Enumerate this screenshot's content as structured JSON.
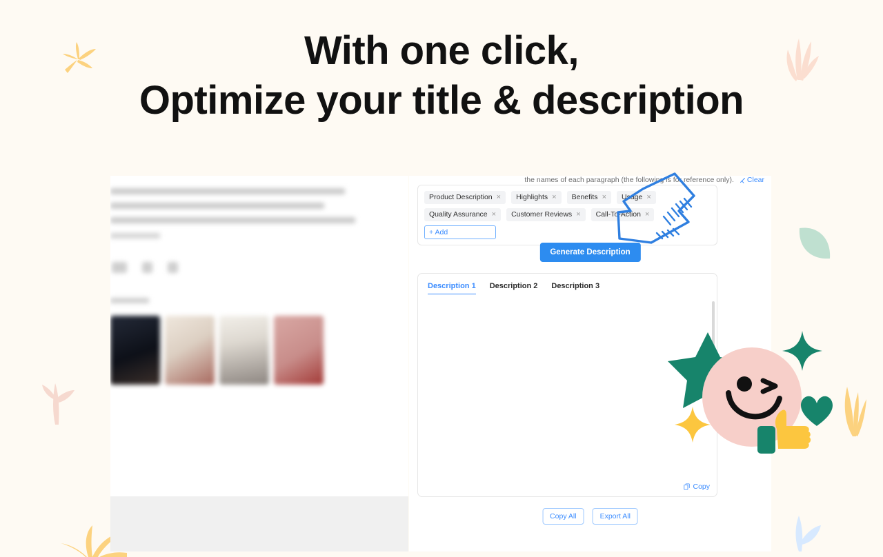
{
  "headline": {
    "line1": "With one click,",
    "line2": "Optimize your title & description"
  },
  "colors": {
    "background": "#fefaf3",
    "accent_blue": "#3b8cff",
    "button_blue": "#2d8cf0",
    "tag_grey": "#f2f3f5",
    "sticker_pink": "#f7cfc9",
    "sticker_green": "#17846b",
    "sticker_yellow": "#fcc63f",
    "leaf_mint": "#bfe0d0",
    "leaf_peach": "#fbded0",
    "leaf_yellow": "#fcd27f",
    "sprout_blue": "#d7e9ff"
  },
  "panel": {
    "hint_text": "the names of each paragraph (the following is for reference only).",
    "clear_label": "Clear",
    "clear_icon": "broom-icon",
    "tags": [
      {
        "label": "Product Description",
        "remove_icon": "close-icon"
      },
      {
        "label": "Highlights",
        "remove_icon": "close-icon"
      },
      {
        "label": "Benefits",
        "remove_icon": "close-icon"
      },
      {
        "label": "Usage",
        "remove_icon": "close-icon"
      },
      {
        "label": "Quality Assurance",
        "remove_icon": "close-icon"
      },
      {
        "label": "Customer Reviews",
        "remove_icon": "close-icon"
      },
      {
        "label": "Call-To-Action",
        "remove_icon": "close-icon"
      }
    ],
    "add_tag_placeholder": "+ Add",
    "add_tag_value": "",
    "generate_button": "Generate Description",
    "tabs": [
      {
        "label": "Description 1",
        "active": true
      },
      {
        "label": "Description 2",
        "active": false
      },
      {
        "label": "Description 3",
        "active": false
      }
    ],
    "result_text": "",
    "copy_label": "Copy",
    "copy_icon": "copy-icon",
    "footer_buttons": [
      {
        "label": "Copy All"
      },
      {
        "label": "Export All"
      }
    ]
  },
  "decorations": [
    {
      "name": "leaf-yellow-top-left"
    },
    {
      "name": "leaf-peach-top-right"
    },
    {
      "name": "cactus-pink-left"
    },
    {
      "name": "leaf-mint-right"
    },
    {
      "name": "wheat-yellow-right"
    },
    {
      "name": "sprout-blue-bottom-right"
    },
    {
      "name": "grass-yellow-bottom-left"
    },
    {
      "name": "smiley-sticker"
    },
    {
      "name": "hand-drawn-arrow"
    }
  ]
}
